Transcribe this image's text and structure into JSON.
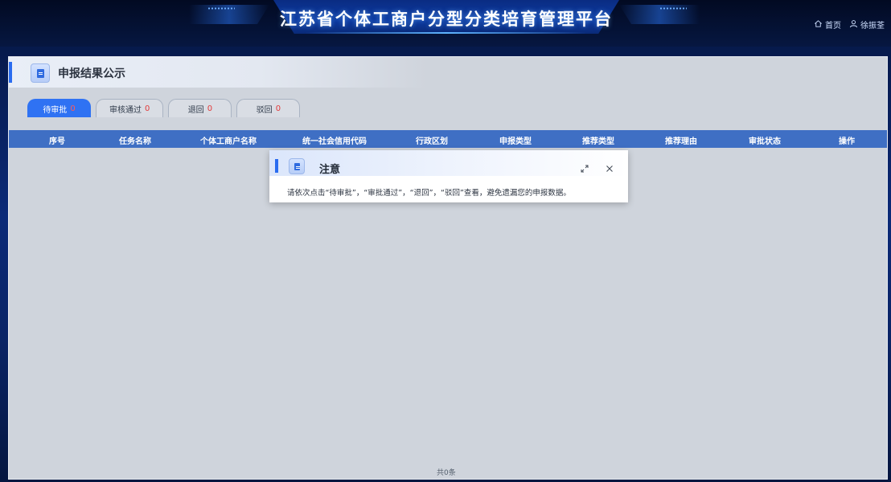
{
  "header": {
    "title": "江苏省个体工商户分型分类培育管理平台",
    "nav": {
      "home_label": "首页",
      "user_label": "徐振荃"
    }
  },
  "panel": {
    "title": "申报结果公示",
    "tabs": [
      {
        "label": "待审批",
        "count": "0",
        "active": true
      },
      {
        "label": "审核通过",
        "count": "0",
        "active": false
      },
      {
        "label": "退回",
        "count": "0",
        "active": false
      },
      {
        "label": "驳回",
        "count": "0",
        "active": false
      }
    ],
    "columns": [
      "序号",
      "任务名称",
      "个体工商户名称",
      "统一社会信用代码",
      "行政区划",
      "申报类型",
      "推荐类型",
      "推荐理由",
      "审批状态",
      "操作"
    ],
    "rows": [],
    "total": "共0条"
  },
  "dialog": {
    "title": "注意",
    "message": "请依次点击“待审批”，“审批通过”，“退回”，“驳回”查看，避免遗漏您的申报数据。"
  },
  "icons": {
    "home": "home-icon",
    "user": "user-icon",
    "document": "document-icon",
    "expand": "expand-icon",
    "close": "close-icon"
  },
  "colors": {
    "accent": "#2f72f3",
    "table_header": "#3f6fc4",
    "count_red": "#e23b3b"
  }
}
